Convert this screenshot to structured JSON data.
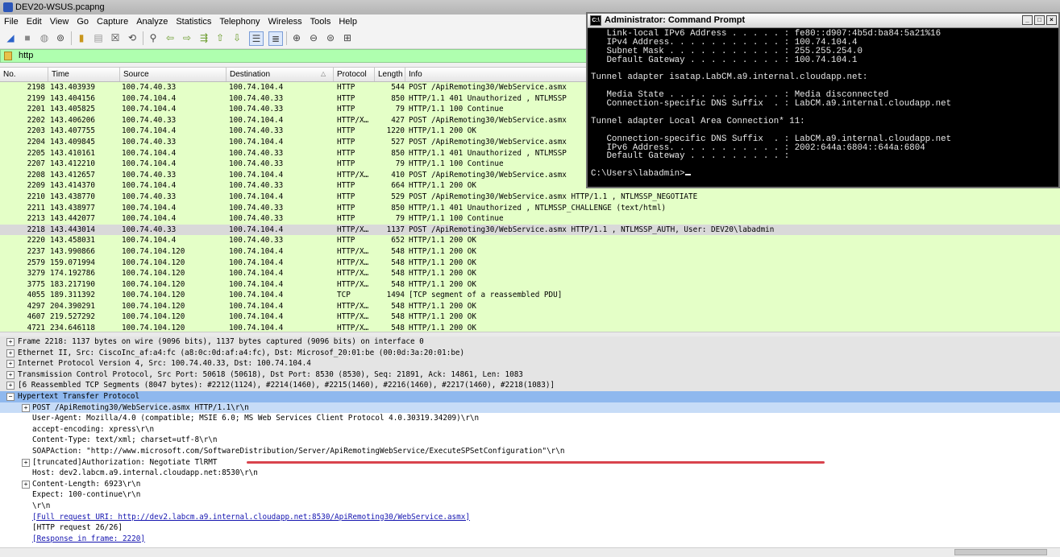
{
  "window_title": "DEV20-WSUS.pcapng",
  "menu": [
    "File",
    "Edit",
    "View",
    "Go",
    "Capture",
    "Analyze",
    "Statistics",
    "Telephony",
    "Wireless",
    "Tools",
    "Help"
  ],
  "filter": {
    "value": "http"
  },
  "columns": [
    "No.",
    "Time",
    "Source",
    "Destination",
    "Protocol",
    "Length",
    "Info"
  ],
  "packets": [
    {
      "no": "2198",
      "time": "143.403939",
      "src": "100.74.40.33",
      "dst": "100.74.104.4",
      "proto": "HTTP",
      "len": "544",
      "info": "POST /ApiRemoting30/WebService.asmx"
    },
    {
      "no": "2199",
      "time": "143.404156",
      "src": "100.74.104.4",
      "dst": "100.74.40.33",
      "proto": "HTTP",
      "len": "850",
      "info": "HTTP/1.1 401 Unauthorized , NTLMSSP"
    },
    {
      "no": "2201",
      "time": "143.405825",
      "src": "100.74.104.4",
      "dst": "100.74.40.33",
      "proto": "HTTP",
      "len": "79",
      "info": "HTTP/1.1 100 Continue"
    },
    {
      "no": "2202",
      "time": "143.406206",
      "src": "100.74.40.33",
      "dst": "100.74.104.4",
      "proto": "HTTP/X…",
      "len": "427",
      "info": "POST /ApiRemoting30/WebService.asmx"
    },
    {
      "no": "2203",
      "time": "143.407755",
      "src": "100.74.104.4",
      "dst": "100.74.40.33",
      "proto": "HTTP",
      "len": "1220",
      "info": "HTTP/1.1 200 OK"
    },
    {
      "no": "2204",
      "time": "143.409845",
      "src": "100.74.40.33",
      "dst": "100.74.104.4",
      "proto": "HTTP",
      "len": "527",
      "info": "POST /ApiRemoting30/WebService.asmx"
    },
    {
      "no": "2205",
      "time": "143.410161",
      "src": "100.74.104.4",
      "dst": "100.74.40.33",
      "proto": "HTTP",
      "len": "850",
      "info": "HTTP/1.1 401 Unauthorized , NTLMSSP"
    },
    {
      "no": "2207",
      "time": "143.412210",
      "src": "100.74.104.4",
      "dst": "100.74.40.33",
      "proto": "HTTP",
      "len": "79",
      "info": "HTTP/1.1 100 Continue"
    },
    {
      "no": "2208",
      "time": "143.412657",
      "src": "100.74.40.33",
      "dst": "100.74.104.4",
      "proto": "HTTP/X…",
      "len": "410",
      "info": "POST /ApiRemoting30/WebService.asmx"
    },
    {
      "no": "2209",
      "time": "143.414370",
      "src": "100.74.104.4",
      "dst": "100.74.40.33",
      "proto": "HTTP",
      "len": "664",
      "info": "HTTP/1.1 200 OK"
    },
    {
      "no": "2210",
      "time": "143.438770",
      "src": "100.74.40.33",
      "dst": "100.74.104.4",
      "proto": "HTTP",
      "len": "529",
      "info": "POST /ApiRemoting30/WebService.asmx HTTP/1.1 , NTLMSSP_NEGOTIATE"
    },
    {
      "no": "2211",
      "time": "143.438977",
      "src": "100.74.104.4",
      "dst": "100.74.40.33",
      "proto": "HTTP",
      "len": "850",
      "info": "HTTP/1.1 401 Unauthorized , NTLMSSP_CHALLENGE (text/html)"
    },
    {
      "no": "2213",
      "time": "143.442077",
      "src": "100.74.104.4",
      "dst": "100.74.40.33",
      "proto": "HTTP",
      "len": "79",
      "info": "HTTP/1.1 100 Continue"
    },
    {
      "no": "2218",
      "time": "143.443014",
      "src": "100.74.40.33",
      "dst": "100.74.104.4",
      "proto": "HTTP/X…",
      "len": "1137",
      "info": "POST /ApiRemoting30/WebService.asmx HTTP/1.1 , NTLMSSP_AUTH, User: DEV20\\labadmin",
      "selected": true
    },
    {
      "no": "2220",
      "time": "143.458031",
      "src": "100.74.104.4",
      "dst": "100.74.40.33",
      "proto": "HTTP",
      "len": "652",
      "info": "HTTP/1.1 200 OK"
    },
    {
      "no": "2237",
      "time": "143.990866",
      "src": "100.74.104.120",
      "dst": "100.74.104.4",
      "proto": "HTTP/X…",
      "len": "548",
      "info": "HTTP/1.1 200 OK"
    },
    {
      "no": "2579",
      "time": "159.071994",
      "src": "100.74.104.120",
      "dst": "100.74.104.4",
      "proto": "HTTP/X…",
      "len": "548",
      "info": "HTTP/1.1 200 OK"
    },
    {
      "no": "3279",
      "time": "174.192786",
      "src": "100.74.104.120",
      "dst": "100.74.104.4",
      "proto": "HTTP/X…",
      "len": "548",
      "info": "HTTP/1.1 200 OK"
    },
    {
      "no": "3775",
      "time": "183.217190",
      "src": "100.74.104.120",
      "dst": "100.74.104.4",
      "proto": "HTTP/X…",
      "len": "548",
      "info": "HTTP/1.1 200 OK"
    },
    {
      "no": "4055",
      "time": "189.311392",
      "src": "100.74.104.120",
      "dst": "100.74.104.4",
      "proto": "TCP",
      "len": "1494",
      "info": "[TCP segment of a reassembled PDU]"
    },
    {
      "no": "4297",
      "time": "204.390291",
      "src": "100.74.104.120",
      "dst": "100.74.104.4",
      "proto": "HTTP/X…",
      "len": "548",
      "info": "HTTP/1.1 200 OK"
    },
    {
      "no": "4607",
      "time": "219.527292",
      "src": "100.74.104.120",
      "dst": "100.74.104.4",
      "proto": "HTTP/X…",
      "len": "548",
      "info": "HTTP/1.1 200 OK"
    },
    {
      "no": "4721",
      "time": "234.646118",
      "src": "100.74.104.120",
      "dst": "100.74.104.4",
      "proto": "HTTP/X…",
      "len": "548",
      "info": "HTTP/1.1 200 OK"
    }
  ],
  "details": [
    {
      "text": "Frame 2218: 1137 bytes on wire (9096 bits), 1137 bytes captured (9096 bits) on interface 0",
      "indent": 0,
      "expander": "+",
      "style": "shade"
    },
    {
      "text": "Ethernet II, Src: CiscoInc_af:a4:fc (a8:0c:0d:af:a4:fc), Dst: Microsof_20:01:be (00:0d:3a:20:01:be)",
      "indent": 0,
      "expander": "+",
      "style": "shade"
    },
    {
      "text": "Internet Protocol Version 4, Src: 100.74.40.33, Dst: 100.74.104.4",
      "indent": 0,
      "expander": "+",
      "style": "shade"
    },
    {
      "text": "Transmission Control Protocol, Src Port: 50618 (50618), Dst Port: 8530 (8530), Seq: 21891, Ack: 14861, Len: 1083",
      "indent": 0,
      "expander": "+",
      "style": "shade"
    },
    {
      "text": "[6 Reassembled TCP Segments (8047 bytes): #2212(1124), #2214(1460), #2215(1460), #2216(1460), #2217(1460), #2218(1083)]",
      "indent": 0,
      "expander": "+",
      "style": "shade"
    },
    {
      "text": "Hypertext Transfer Protocol",
      "indent": 0,
      "expander": "-",
      "style": "hl"
    },
    {
      "text": "POST /ApiRemoting30/WebService.asmx HTTP/1.1\\r\\n",
      "indent": 1,
      "expander": "+",
      "style": "sub"
    },
    {
      "text": "User-Agent: Mozilla/4.0 (compatible; MSIE 6.0; MS Web Services Client Protocol 4.0.30319.34209)\\r\\n",
      "indent": 1,
      "expander": "",
      "style": ""
    },
    {
      "text": "accept-encoding: xpress\\r\\n",
      "indent": 1,
      "expander": "",
      "style": ""
    },
    {
      "text": "Content-Type: text/xml; charset=utf-8\\r\\n",
      "indent": 1,
      "expander": "",
      "style": ""
    },
    {
      "text": "SOAPAction: \"http://www.microsoft.com/SoftwareDistribution/Server/ApiRemotingWebService/ExecuteSPSetConfiguration\"\\r\\n",
      "indent": 1,
      "expander": "",
      "style": ""
    },
    {
      "text": " [truncated]Authorization: Negotiate TlRMT",
      "indent": 1,
      "expander": "+",
      "style": ""
    },
    {
      "text": "Host: dev2.labcm.a9.internal.cloudapp.net:8530\\r\\n",
      "indent": 1,
      "expander": "",
      "style": ""
    },
    {
      "text": "Content-Length: 6923\\r\\n",
      "indent": 1,
      "expander": "+",
      "style": ""
    },
    {
      "text": "Expect: 100-continue\\r\\n",
      "indent": 1,
      "expander": "",
      "style": ""
    },
    {
      "text": "\\r\\n",
      "indent": 1,
      "expander": "",
      "style": ""
    },
    {
      "text": "[Full request URI: http://dev2.labcm.a9.internal.cloudapp.net:8530/ApiRemoting30/WebService.asmx]",
      "indent": 1,
      "expander": "",
      "style": "link"
    },
    {
      "text": "[HTTP request 26/26]",
      "indent": 1,
      "expander": "",
      "style": ""
    },
    {
      "text": "[Response in frame: 2220]",
      "indent": 1,
      "expander": "",
      "style": "link"
    }
  ],
  "cmd": {
    "title": "Administrator: Command Prompt",
    "lines": [
      "   Link-local IPv6 Address . . . . . : fe80::d907:4b5d:ba84:5a21%16",
      "   IPv4 Address. . . . . . . . . . . : 100.74.104.4",
      "   Subnet Mask . . . . . . . . . . . : 255.255.254.0",
      "   Default Gateway . . . . . . . . . : 100.74.104.1",
      "",
      "Tunnel adapter isatap.LabCM.a9.internal.cloudapp.net:",
      "",
      "   Media State . . . . . . . . . . . : Media disconnected",
      "   Connection-specific DNS Suffix  . : LabCM.a9.internal.cloudapp.net",
      "",
      "Tunnel adapter Local Area Connection* 11:",
      "",
      "   Connection-specific DNS Suffix  . : LabCM.a9.internal.cloudapp.net",
      "   IPv6 Address. . . . . . . . . . . : 2002:644a:6804::644a:6804",
      "   Default Gateway . . . . . . . . . :",
      "",
      "C:\\Users\\labadmin>"
    ]
  },
  "colors": {
    "packet_row_bg": "#e4ffc7",
    "selected_row_bg": "#d9d9d9",
    "filter_bg": "#afffaf",
    "http_highlight": "#8fb8ee",
    "annotation_red": "#d9434d"
  }
}
